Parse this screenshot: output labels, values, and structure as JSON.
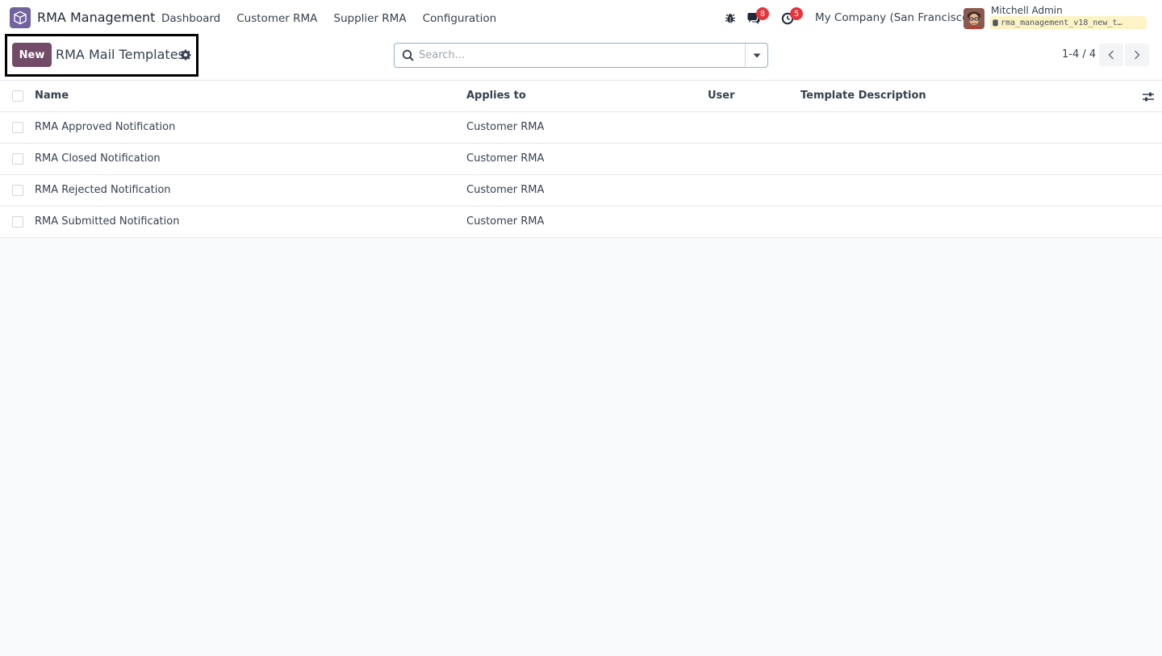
{
  "navbar": {
    "app_name": "RMA Management",
    "menu": [
      "Dashboard",
      "Customer RMA",
      "Supplier RMA",
      "Configuration"
    ],
    "messages_count": "8",
    "activities_count": "5",
    "company": "My Company (San Francisco)",
    "user_name": "Mitchell Admin",
    "database": "rma_management_v18_new_t…"
  },
  "control_panel": {
    "new_label": "New",
    "title": "RMA Mail Templates",
    "search_placeholder": "Search...",
    "pager": "1-4 / 4"
  },
  "list": {
    "columns": [
      "Name",
      "Applies to",
      "User",
      "Template Description"
    ],
    "rows": [
      {
        "name": "RMA Approved Notification",
        "applies_to": "Customer RMA",
        "user": "",
        "description": ""
      },
      {
        "name": "RMA Closed Notification",
        "applies_to": "Customer RMA",
        "user": "",
        "description": ""
      },
      {
        "name": "RMA Rejected Notification",
        "applies_to": "Customer RMA",
        "user": "",
        "description": ""
      },
      {
        "name": "RMA Submitted Notification",
        "applies_to": "Customer RMA",
        "user": "",
        "description": ""
      }
    ]
  },
  "colors": {
    "primary": "#714b67",
    "badge": "#e6343c",
    "db_badge_bg": "#fdf3c4"
  }
}
